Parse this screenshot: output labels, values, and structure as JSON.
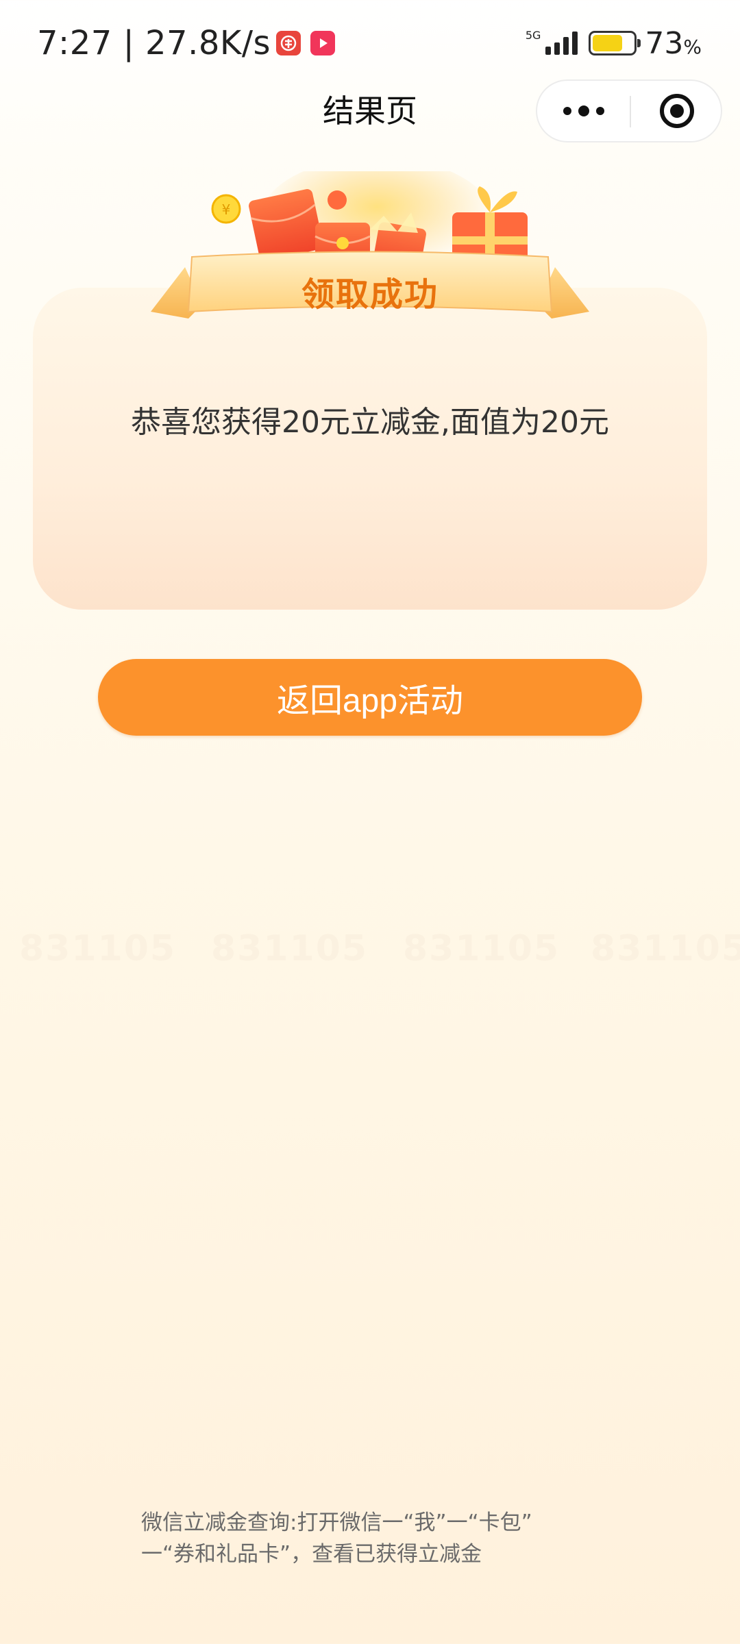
{
  "status_bar": {
    "time": "7:27",
    "separator": "|",
    "net_speed": "27.8K/s",
    "network_type": "5G",
    "battery_percent": "73",
    "battery_unit": "%",
    "battery_level": 0.73,
    "battery_color": "#f5d215",
    "app_icons": [
      "bank-app-icon",
      "video-app-icon"
    ]
  },
  "nav": {
    "title": "结果页",
    "more_icon": "more-dots-icon",
    "close_icon": "miniprogram-close-icon"
  },
  "banner": {
    "title": "领取成功"
  },
  "card": {
    "message": "恭喜您获得20元立减金,面值为20元"
  },
  "actions": {
    "return_label": "返回app活动"
  },
  "footer": {
    "line1": "微信立减金查询:打开微信一“我”一“卡包”",
    "line2": "一“券和礼品卡”，查看已获得立减金"
  },
  "watermark": {
    "text": "831105"
  },
  "colors": {
    "accent": "#fc922c",
    "banner_text": "#e8720d"
  }
}
